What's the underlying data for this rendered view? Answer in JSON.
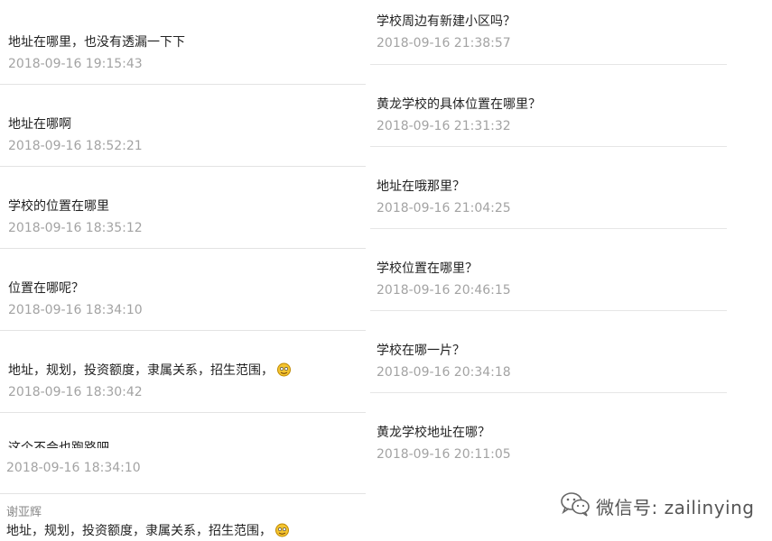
{
  "left": [
    {
      "content": "地址在哪里，也没有透漏一下下",
      "time": "2018-09-16 19:15:43"
    },
    {
      "content": "地址在哪啊",
      "time": "2018-09-16 18:52:21"
    },
    {
      "content": "学校的位置在哪里",
      "time": "2018-09-16 18:35:12"
    },
    {
      "content": "位置在哪呢？",
      "time": "2018-09-16 18:34:10"
    },
    {
      "content": "地址，规划，投资额度，隶属关系，招生范围，",
      "time": "2018-09-16 18:30:42"
    },
    {
      "content": "这个不会也跑路吧",
      "time": "2018-09-16 18:34:10"
    },
    {
      "author": "谢亚辉",
      "content": "地址，规划，投资额度，隶属关系，招生范围，"
    }
  ],
  "right": [
    {
      "content": "学校周边有新建小区吗？",
      "time": "2018-09-16 21:38:57"
    },
    {
      "content": "黄龙学校的具体位置在哪里？",
      "time": "2018-09-16 21:31:32"
    },
    {
      "content": "地址在哦那里？",
      "time": "2018-09-16 21:04:25"
    },
    {
      "content": "学校位置在哪里？",
      "time": "2018-09-16 20:46:15"
    },
    {
      "content": "学校在哪一片？",
      "time": "2018-09-16 20:34:18"
    },
    {
      "content": "黄龙学校地址在哪？",
      "time": "2018-09-16 20:11:05"
    }
  ],
  "watermark": {
    "text": "微信号: zailinying",
    "icon": "wechat-icon"
  },
  "colors": {
    "content": "#222222",
    "time": "#a3a3a3",
    "divider": "#e3e3e3"
  }
}
